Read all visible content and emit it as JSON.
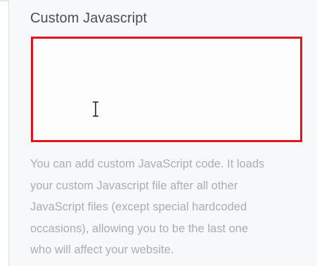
{
  "custom_js": {
    "label": "Custom Javascript",
    "code_value": "",
    "help_lines": [
      "You can add custom JavaScript code. It loads",
      "your custom Javascript file after all other",
      "JavaScript files (except special hardcoded",
      "occasions), allowing you to be the last one",
      "who will affect your website."
    ]
  },
  "icons": {
    "cursor": "text-cursor-icon"
  },
  "colors": {
    "highlight_border": "#e0141e",
    "label_text": "#4a4f57",
    "help_text": "#a9adb4",
    "panel_bg": "#f7f8fa"
  }
}
